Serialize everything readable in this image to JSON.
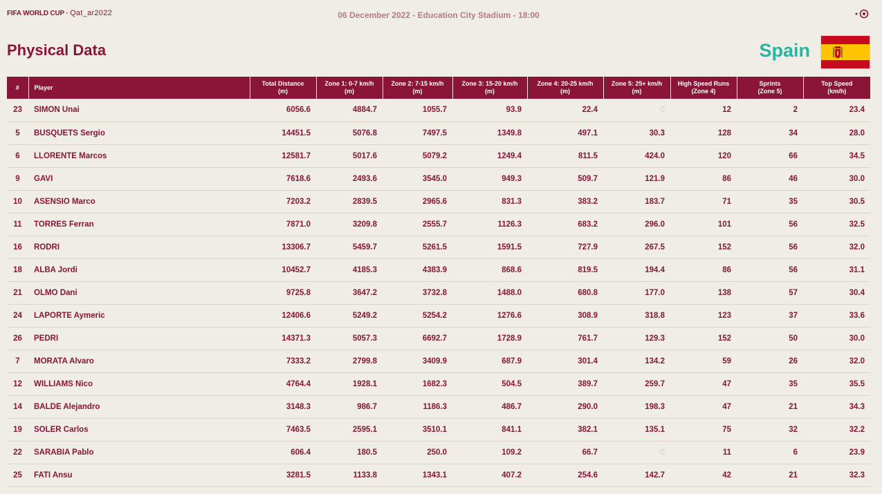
{
  "header": {
    "brand_main": "FIFA WORLD CUP",
    "brand_sub": "Qat_ar2022",
    "match_info": "06 December 2022 - Education City Stadium - 18:00"
  },
  "page": {
    "title": "Physical Data",
    "team": "Spain"
  },
  "colors": {
    "primary": "#8a1538",
    "accent": "#27b6a3",
    "background": "#efede6"
  },
  "table": {
    "columns": [
      {
        "key": "no",
        "label": "#"
      },
      {
        "key": "player",
        "label": "Player"
      },
      {
        "key": "total",
        "label": "Total Distance\n(m)"
      },
      {
        "key": "z1",
        "label": "Zone 1: 0-7 km/h\n(m)"
      },
      {
        "key": "z2",
        "label": "Zone 2: 7-15 km/h\n(m)"
      },
      {
        "key": "z3",
        "label": "Zone 3: 15-20 km/h\n(m)"
      },
      {
        "key": "z4",
        "label": "Zone 4: 20-25 km/h\n(m)"
      },
      {
        "key": "z5",
        "label": "Zone 5: 25+ km/h\n(m)"
      },
      {
        "key": "hsr",
        "label": "High Speed Runs\n(Zone 4)"
      },
      {
        "key": "sprints",
        "label": "Sprints\n(Zone 5)"
      },
      {
        "key": "top",
        "label": "Top Speed\n(km/h)"
      }
    ],
    "rows": [
      [
        "23",
        "SIMON Unai",
        "6056.6",
        "4884.7",
        "1055.7",
        "93.9",
        "22.4",
        "0",
        "12",
        "2",
        "23.4"
      ],
      [
        "5",
        "BUSQUETS Sergio",
        "14451.5",
        "5076.8",
        "7497.5",
        "1349.8",
        "497.1",
        "30.3",
        "128",
        "34",
        "28.0"
      ],
      [
        "6",
        "LLORENTE Marcos",
        "12581.7",
        "5017.6",
        "5079.2",
        "1249.4",
        "811.5",
        "424.0",
        "120",
        "66",
        "34.5"
      ],
      [
        "9",
        "GAVI",
        "7618.6",
        "2493.6",
        "3545.0",
        "949.3",
        "509.7",
        "121.9",
        "86",
        "46",
        "30.0"
      ],
      [
        "10",
        "ASENSIO Marco",
        "7203.2",
        "2839.5",
        "2965.6",
        "831.3",
        "383.2",
        "183.7",
        "71",
        "35",
        "30.5"
      ],
      [
        "11",
        "TORRES Ferran",
        "7871.0",
        "3209.8",
        "2555.7",
        "1126.3",
        "683.2",
        "296.0",
        "101",
        "56",
        "32.5"
      ],
      [
        "16",
        "RODRI",
        "13306.7",
        "5459.7",
        "5261.5",
        "1591.5",
        "727.9",
        "267.5",
        "152",
        "56",
        "32.0"
      ],
      [
        "18",
        "ALBA Jordi",
        "10452.7",
        "4185.3",
        "4383.9",
        "868.6",
        "819.5",
        "194.4",
        "86",
        "56",
        "31.1"
      ],
      [
        "21",
        "OLMO Dani",
        "9725.8",
        "3647.2",
        "3732.8",
        "1488.0",
        "680.8",
        "177.0",
        "138",
        "57",
        "30.4"
      ],
      [
        "24",
        "LAPORTE Aymeric",
        "12406.6",
        "5249.2",
        "5254.2",
        "1276.6",
        "308.9",
        "318.8",
        "123",
        "37",
        "33.6"
      ],
      [
        "26",
        "PEDRI",
        "14371.3",
        "5057.3",
        "6692.7",
        "1728.9",
        "761.7",
        "129.3",
        "152",
        "50",
        "30.0"
      ],
      [
        "7",
        "MORATA Alvaro",
        "7333.2",
        "2799.8",
        "3409.9",
        "687.9",
        "301.4",
        "134.2",
        "59",
        "26",
        "32.0"
      ],
      [
        "12",
        "WILLIAMS Nico",
        "4764.4",
        "1928.1",
        "1682.3",
        "504.5",
        "389.7",
        "259.7",
        "47",
        "35",
        "35.5"
      ],
      [
        "14",
        "BALDE Alejandro",
        "3148.3",
        "986.7",
        "1186.3",
        "486.7",
        "290.0",
        "198.3",
        "47",
        "21",
        "34.3"
      ],
      [
        "19",
        "SOLER Carlos",
        "7463.5",
        "2595.1",
        "3510.1",
        "841.1",
        "382.1",
        "135.1",
        "75",
        "32",
        "32.2"
      ],
      [
        "22",
        "SARABIA Pablo",
        "606.4",
        "180.5",
        "250.0",
        "109.2",
        "66.7",
        "0",
        "11",
        "6",
        "23.9"
      ],
      [
        "25",
        "FATI Ansu",
        "3281.5",
        "1133.8",
        "1343.1",
        "407.2",
        "254.6",
        "142.7",
        "42",
        "21",
        "32.3"
      ]
    ]
  }
}
